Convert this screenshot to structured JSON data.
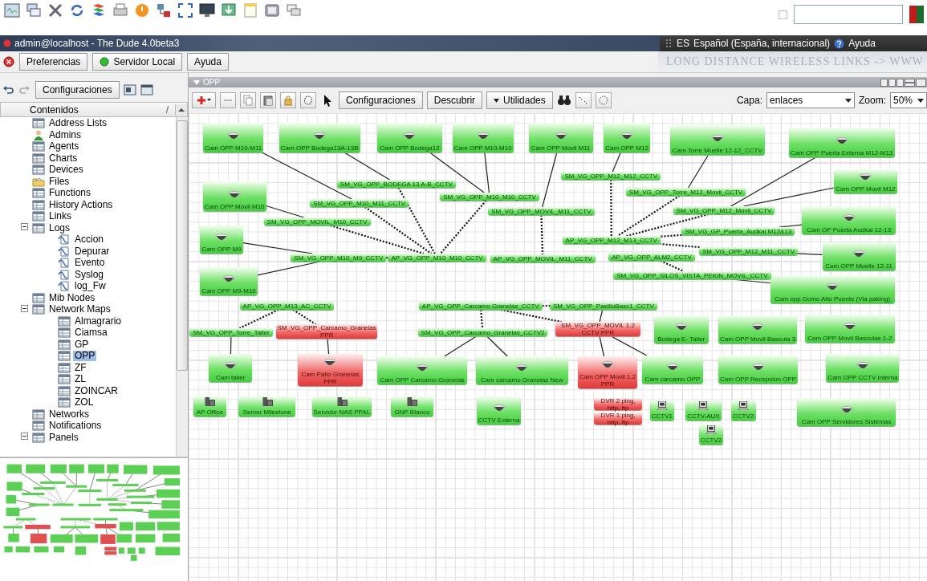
{
  "taskbar": {
    "checkbox": {
      "checked": false
    }
  },
  "window": {
    "title": "admin@localhost - The Dude 4.0beta3",
    "language_code": "ES",
    "language": "Español (España, internacional)",
    "help": "Ayuda"
  },
  "menu": {
    "buttons": [
      {
        "label": "Preferencias",
        "kind": "plain"
      },
      {
        "label": "Servidor Local",
        "kind": "server",
        "connected": true
      },
      {
        "label": "Ayuda",
        "kind": "plain"
      }
    ],
    "banner": "LONG DISTANCE WIRELESS LINKS -> WWW"
  },
  "left_toolbar": {
    "button": "Configuraciones"
  },
  "sidebar": {
    "header": "Contenidos",
    "sort": "/",
    "items": [
      {
        "label": "Address Lists",
        "kind": "table",
        "selected": false
      },
      {
        "label": "Admins",
        "kind": "admin",
        "selected": false
      },
      {
        "label": "Agents",
        "kind": "table",
        "selected": false
      },
      {
        "label": "Charts",
        "kind": "table",
        "selected": false
      },
      {
        "label": "Devices",
        "kind": "table",
        "selected": false
      },
      {
        "label": "Files",
        "kind": "folder",
        "selected": false
      },
      {
        "label": "Functions",
        "kind": "table",
        "selected": false
      },
      {
        "label": "History Actions",
        "kind": "table",
        "selected": false
      },
      {
        "label": "Links",
        "kind": "table",
        "selected": false
      },
      {
        "label": "Logs",
        "kind": "table",
        "selected": false,
        "expanded": true,
        "children": [
          {
            "label": "Accion",
            "kind": "log",
            "selected": false
          },
          {
            "label": "Depurar",
            "kind": "log",
            "selected": false
          },
          {
            "label": "Evento",
            "kind": "log",
            "selected": false
          },
          {
            "label": "Syslog",
            "kind": "log",
            "selected": false
          },
          {
            "label": "log_Fw",
            "kind": "log",
            "selected": false
          }
        ]
      },
      {
        "label": "Mib Nodes",
        "kind": "table",
        "selected": false
      },
      {
        "label": "Network Maps",
        "kind": "table",
        "selected": false,
        "expanded": true,
        "children": [
          {
            "label": "Almagrario",
            "kind": "table",
            "selected": false
          },
          {
            "label": "Ciamsa",
            "kind": "table",
            "selected": false
          },
          {
            "label": "GP",
            "kind": "table",
            "selected": false
          },
          {
            "label": "OPP",
            "kind": "table",
            "selected": true
          },
          {
            "label": "ZF",
            "kind": "table",
            "selected": false
          },
          {
            "label": "ZL",
            "kind": "table",
            "selected": false
          },
          {
            "label": "ZOINCAR",
            "kind": "table",
            "selected": false
          },
          {
            "label": "ZOL",
            "kind": "table",
            "selected": false
          }
        ]
      },
      {
        "label": "Networks",
        "kind": "table",
        "selected": false
      },
      {
        "label": "Notifications",
        "kind": "table",
        "selected": false
      },
      {
        "label": "Panels",
        "kind": "table",
        "selected": false,
        "expanded": true
      }
    ]
  },
  "map": {
    "title": "OPP",
    "toolbar": {
      "settings": "Configuraciones",
      "discover": "Descubrir",
      "tools": "Utilidades",
      "layer_label": "Capa:",
      "layer": "enlaces",
      "zoom_label": "Zoom:",
      "zoom": "50%"
    },
    "nodes": [
      {
        "label": "Cam OPP M10-M11",
        "kind": "camera",
        "down": false
      },
      {
        "label": "Cam OPP Bodega13A-13B",
        "kind": "camera",
        "down": false
      },
      {
        "label": "Cam OPP Bodega12",
        "kind": "camera",
        "down": false
      },
      {
        "label": "Cam OPP M10-M10",
        "kind": "camera",
        "down": false
      },
      {
        "label": "Cam OPP  Movil M11",
        "kind": "camera",
        "down": false
      },
      {
        "label": "Cam OPP M12",
        "kind": "camera",
        "down": false
      },
      {
        "label": "Cam Torre Muelle 12-12_CCTV",
        "kind": "camera",
        "down": false
      },
      {
        "label": "Cam OPP Puerta Externa M12-M13",
        "kind": "camera",
        "down": false
      },
      {
        "label": "Cam OPP Movil M10",
        "kind": "camera",
        "down": false
      },
      {
        "label": "Cam OPP M9",
        "kind": "camera",
        "down": false
      },
      {
        "label": "Cam OPP M9-M10",
        "kind": "camera",
        "down": false
      },
      {
        "label": "Cam OPP Movil M12",
        "kind": "camera",
        "down": false
      },
      {
        "label": "Cam OP  Puerta Audkai 12-13",
        "kind": "camera",
        "down": false
      },
      {
        "label": "Cam OPP Muelle 12-11",
        "kind": "camera",
        "down": false
      },
      {
        "label": "Cam opp Domo Alto Puente (Via paking)",
        "kind": "camera",
        "down": false
      },
      {
        "label": "SM_VG_OPP_BODEGA 13 A-B_CCTV",
        "kind": "link",
        "down": false
      },
      {
        "label": "SM_VG_OPP_M10_M11_CCTV",
        "kind": "link",
        "down": false
      },
      {
        "label": "SM_VG_OPP_M10_M10_CCTV",
        "kind": "link",
        "down": false
      },
      {
        "label": "SM_VG_OPP_MOVIL_M11_CCTV",
        "kind": "link",
        "down": false
      },
      {
        "label": "SM_VG_OPP_MOVIL_M10_CCTV",
        "kind": "link",
        "down": false
      },
      {
        "label": "SM_VG_OPP_M12_M12_CCTV",
        "kind": "link",
        "down": false
      },
      {
        "label": "SM_VG_OPP_Torre_M12_Movil_CCTV",
        "kind": "link",
        "down": false
      },
      {
        "label": "SM_VG_OPP_M12_Movil_CCTV",
        "kind": "link",
        "down": false
      },
      {
        "label": "SM_VG_GP_Puerta_Audkai M12&13",
        "kind": "link",
        "down": false
      },
      {
        "label": "AP_VG_OPP_M12_M13_CCTV",
        "kind": "link",
        "down": false
      },
      {
        "label": "SM_VG_OPP_M12_M11_CCTV",
        "kind": "link",
        "down": false
      },
      {
        "label": "AP_VG_OPP_ALM2_CCTV",
        "kind": "link",
        "down": false
      },
      {
        "label": "SM_VG_OPP_SILOS_VISTA_PEKIN_MOVIL_CCTV",
        "kind": "link",
        "down": false
      },
      {
        "label": "SM_VG_OPP_M10_M9_CCTV",
        "kind": "link",
        "down": false
      },
      {
        "label": "AP_VG_OPP_M10_M10_CCTV",
        "kind": "link",
        "down": false
      },
      {
        "label": "AP_VG_OPP_MOVIL_M11_CCTV",
        "kind": "link",
        "down": false
      },
      {
        "label": "AP_VG_OPP_M13_AC_CCTV",
        "kind": "link",
        "down": false
      },
      {
        "label": "SM_VG_OPP_Torre_Taller",
        "kind": "link",
        "down": false
      },
      {
        "label": "SM_VG_OPP_Carcamo_Granelas PPR",
        "kind": "link",
        "down": true
      },
      {
        "label": "AP_VG_OPP_Carcamo Granelas_CCTV",
        "kind": "link",
        "down": false
      },
      {
        "label": "SM_VG_OPP_PasilloBasc1_CCTV",
        "kind": "link",
        "down": false
      },
      {
        "label": "SM_VG_OPP_Carcamo_Granelas_CCTV2",
        "kind": "link",
        "down": false
      },
      {
        "label": "SM_VG_OPP_MOVIL 1.2 CCTV PPR",
        "kind": "link",
        "down": true
      },
      {
        "label": "Cam taller",
        "kind": "camera",
        "down": false
      },
      {
        "label": "Cam Patio Granelas PPR",
        "kind": "camera",
        "down": true
      },
      {
        "label": "Cam OPP Carcamo Granelas",
        "kind": "camera",
        "down": false
      },
      {
        "label": "Cam carcamo Granelas New",
        "kind": "camera",
        "down": false
      },
      {
        "label": "Cam OPP Movil 1.2 PPR",
        "kind": "camera",
        "down": true
      },
      {
        "label": "Bodega E- Taller",
        "kind": "camera",
        "down": false
      },
      {
        "label": "Cam OPP Movil Bascula 3",
        "kind": "camera",
        "down": false
      },
      {
        "label": "Cam OPP Movil Basculas 1-2",
        "kind": "camera",
        "down": false
      },
      {
        "label": "Cam carcamo OPP",
        "kind": "camera",
        "down": false
      },
      {
        "label": "Cam OPP Recepcion OPP",
        "kind": "camera",
        "down": false
      },
      {
        "label": "Cam OPP CCTV Interna",
        "kind": "camera",
        "down": false
      },
      {
        "label": "AP Office",
        "kind": "server",
        "down": false
      },
      {
        "label": "Server Milestone",
        "kind": "server",
        "down": false
      },
      {
        "label": "Servidor NAS PPAL",
        "kind": "server",
        "down": false
      },
      {
        "label": "GNP Blanco",
        "kind": "server",
        "down": false
      },
      {
        "label": "CCTV Externa",
        "kind": "camera",
        "down": false
      },
      {
        "label": "DVR 2 ping, http, ftp",
        "kind": "service",
        "down": true
      },
      {
        "label": "DVR 1 ping, http, ftp",
        "kind": "service",
        "down": true
      },
      {
        "label": "CCTV1",
        "kind": "monitor",
        "down": false
      },
      {
        "label": "CCTV-AUX",
        "kind": "monitor",
        "down": false
      },
      {
        "label": "CCTV2",
        "kind": "monitor",
        "down": false
      },
      {
        "label": "CCTV2",
        "kind": "monitor",
        "down": false
      },
      {
        "label": "Cam OPP Servidores Sistemas",
        "kind": "camera",
        "down": false
      }
    ]
  }
}
